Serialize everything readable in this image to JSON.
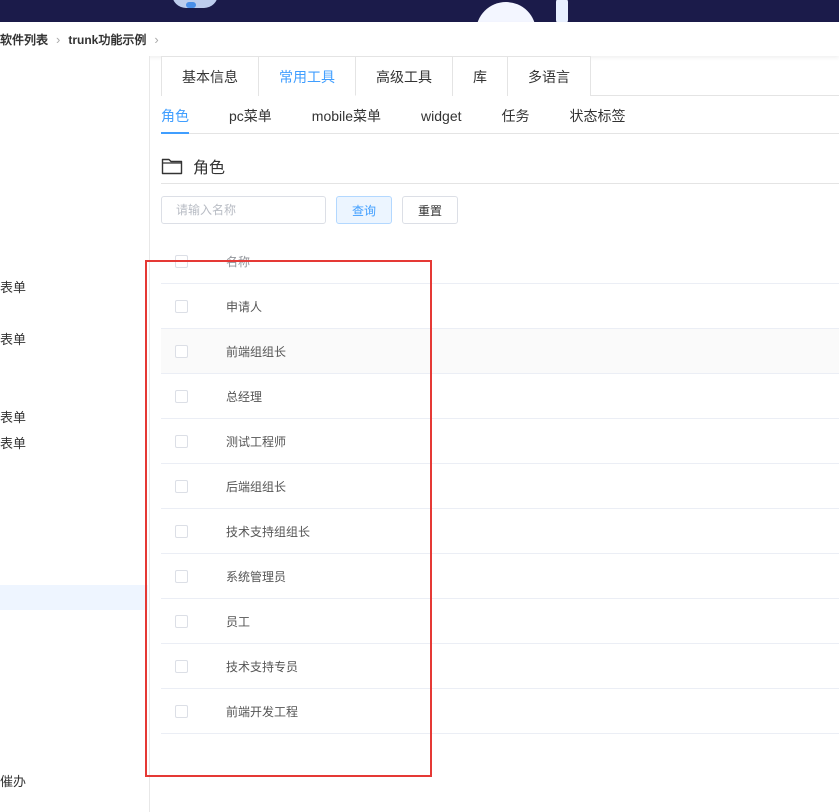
{
  "breadcrumb": {
    "items": [
      "软件列表",
      "trunk功能示例"
    ]
  },
  "sidebar": {
    "items": [
      {
        "label": "表单"
      },
      {
        "label": "表单"
      },
      {
        "label": "表单"
      },
      {
        "label": "表单"
      },
      {
        "label": "催办"
      }
    ]
  },
  "tabs_primary": [
    {
      "label": "基本信息"
    },
    {
      "label": "常用工具",
      "active": true
    },
    {
      "label": "高级工具"
    },
    {
      "label": "库"
    },
    {
      "label": "多语言"
    }
  ],
  "tabs_secondary": [
    {
      "label": "角色",
      "active": true
    },
    {
      "label": "pc菜单"
    },
    {
      "label": "mobile菜单"
    },
    {
      "label": "widget"
    },
    {
      "label": "任务"
    },
    {
      "label": "状态标签"
    }
  ],
  "section": {
    "title": "角色",
    "icon": "folder-icon"
  },
  "search": {
    "placeholder": "请输入名称",
    "value": "",
    "query_label": "查询",
    "reset_label": "重置"
  },
  "table": {
    "columns": [
      "名称"
    ],
    "rows": [
      {
        "name": "申请人"
      },
      {
        "name": "前端组组长"
      },
      {
        "name": "总经理"
      },
      {
        "name": "测试工程师"
      },
      {
        "name": "后端组组长"
      },
      {
        "name": "技术支持组组长"
      },
      {
        "name": "系统管理员"
      },
      {
        "name": "员工"
      },
      {
        "name": "技术支持专员"
      },
      {
        "name": "前端开发工程"
      }
    ]
  },
  "colors": {
    "accent": "#409eff",
    "highlight": "#e53935",
    "banner": "#1b1b4a"
  }
}
